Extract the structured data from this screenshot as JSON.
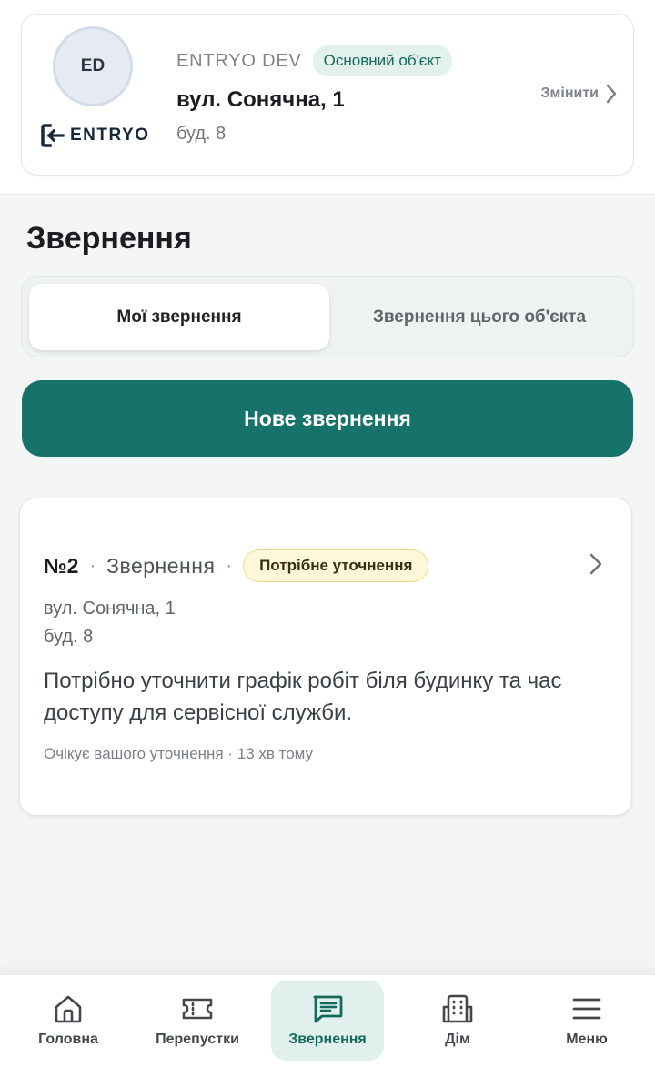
{
  "object": {
    "avatar_initials": "ED",
    "brand": "ENTRYO",
    "org_name": "ENTRYO DEV",
    "primary_badge": "Основний об'єкт",
    "street": "вул. Сонячна, 1",
    "building": "буд. 8",
    "change_label": "Змінити"
  },
  "page": {
    "title": "Звернення"
  },
  "tabs": {
    "mine": "Мої звернення",
    "object": "Звернення цього об'єкта",
    "active": "mine"
  },
  "new_request_label": "Нове звернення",
  "requests": [
    {
      "number": "№2",
      "separator": "·",
      "type": "Звернення",
      "status": "Потрібне уточнення",
      "street": "вул. Сонячна, 1",
      "building": "буд. 8",
      "description": "Потрібно уточнити графік робіт біля будинку та час доступу для сервісної служби.",
      "meta": "Очікує вашого уточнення · 13 хв тому"
    }
  ],
  "bottom_nav": {
    "items": [
      {
        "label": "Головна",
        "icon": "home-icon"
      },
      {
        "label": "Перепустки",
        "icon": "ticket-icon"
      },
      {
        "label": "Звернення",
        "icon": "message-icon"
      },
      {
        "label": "Дім",
        "icon": "building-icon"
      },
      {
        "label": "Меню",
        "icon": "menu-icon"
      }
    ],
    "active": "Звернення"
  },
  "colors": {
    "accent": "#17736a",
    "accent_light": "#e1f0ec",
    "status_badge_bg": "#fff7d9",
    "status_badge_border": "#f0d98a",
    "background": "#f3f6f5"
  }
}
